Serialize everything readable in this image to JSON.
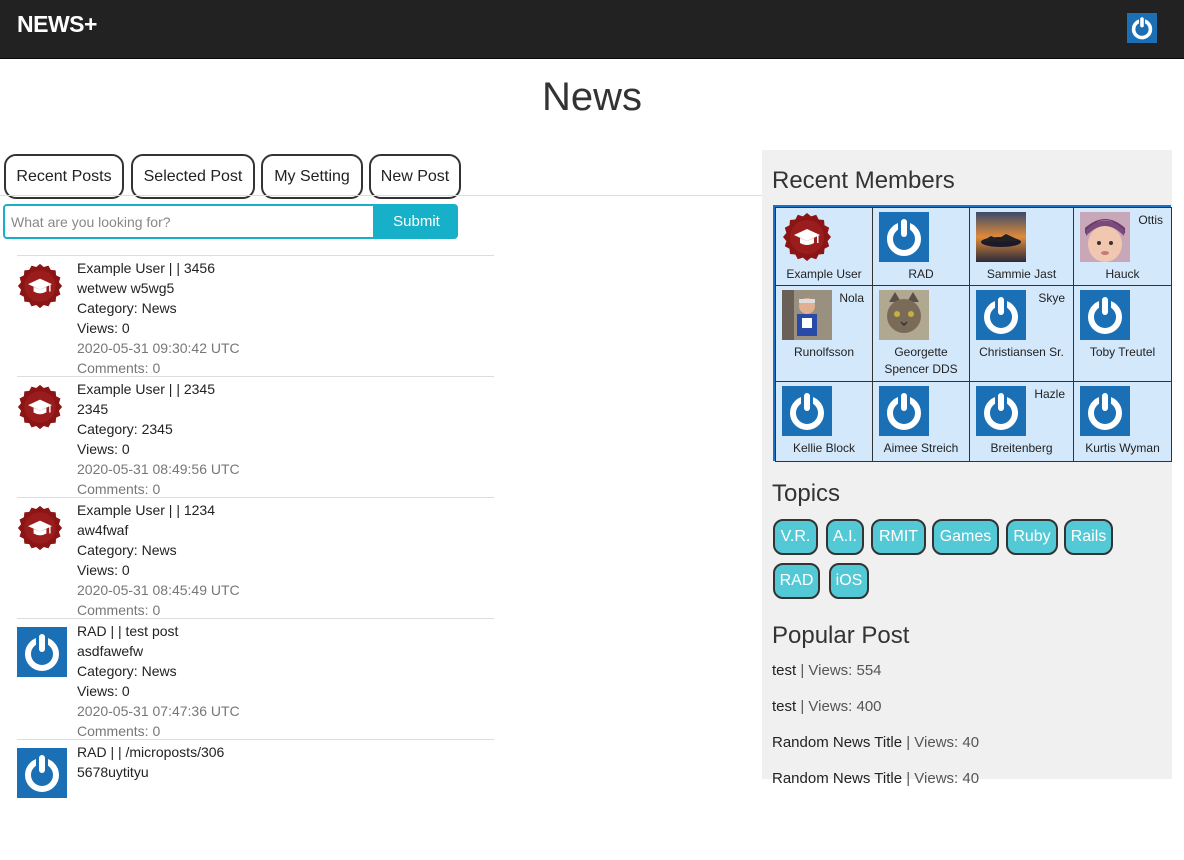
{
  "navbar": {
    "brand": "NEWS+"
  },
  "page_title": "News",
  "tabs": [
    "Recent Posts",
    "Selected Post",
    "My Setting",
    "New Post"
  ],
  "search": {
    "placeholder": "What are you looking for?",
    "button": "Submit"
  },
  "posts": [
    {
      "header": "Example User | | 3456",
      "body": "wetwew w5wg5",
      "category": "Category: News",
      "views": "Views: 0",
      "time": "2020-05-31 09:30:42 UTC",
      "comments": "Comments: 0",
      "avatar": "badge-icon"
    },
    {
      "header": "Example User | | 2345",
      "body": "2345",
      "category": "Category: 2345",
      "views": "Views: 0",
      "time": "2020-05-31 08:49:56 UTC",
      "comments": "Comments: 0",
      "avatar": "badge-icon"
    },
    {
      "header": "Example User | | 1234",
      "body": "aw4fwaf",
      "category": "Category: News",
      "views": "Views: 0",
      "time": "2020-05-31 08:45:49 UTC",
      "comments": "Comments: 0",
      "avatar": "badge-icon"
    },
    {
      "header": "RAD | | test post",
      "body": "asdfawefw",
      "category": "Category: News",
      "views": "Views: 0",
      "time": "2020-05-31 07:47:36 UTC",
      "comments": "Comments: 0",
      "avatar": "power-icon"
    },
    {
      "header": "RAD | | /microposts/306",
      "body": "5678uytityu",
      "category": "",
      "views": "",
      "time": "",
      "comments": "",
      "avatar": "power-icon"
    }
  ],
  "sidebar": {
    "members_heading": "Recent Members",
    "members": [
      {
        "first": "",
        "name": "Example User",
        "img": "badge"
      },
      {
        "first": "",
        "name": "RAD",
        "img": "power"
      },
      {
        "first": "",
        "name": "Sammie Jast",
        "img": "sunset"
      },
      {
        "first": "Ottis",
        "name": "Hauck",
        "img": "baby"
      },
      {
        "first": "Nola",
        "name": "Runolfsson",
        "img": "person"
      },
      {
        "first": "",
        "name": "Georgette Spencer DDS",
        "img": "cat"
      },
      {
        "first": "Skye",
        "name": "Christiansen Sr.",
        "img": "power"
      },
      {
        "first": "",
        "name": "Toby Treutel",
        "img": "power"
      },
      {
        "first": "",
        "name": "Kellie Block",
        "img": "power"
      },
      {
        "first": "",
        "name": "Aimee Streich",
        "img": "power"
      },
      {
        "first": "Hazle",
        "name": "Breitenberg",
        "img": "power"
      },
      {
        "first": "",
        "name": "Kurtis Wyman",
        "img": "power"
      }
    ],
    "topics_heading": "Topics",
    "topics": [
      "V.R.",
      "A.I.",
      "RMIT",
      "Games",
      "Ruby",
      "Rails",
      "RAD",
      "iOS"
    ],
    "popular_heading": "Popular Post",
    "popular": [
      {
        "title": "test",
        "views": " | Views: 554"
      },
      {
        "title": "test",
        "views": " | Views: 400"
      },
      {
        "title": "Random News Title",
        "views": " | Views: 40"
      },
      {
        "title": "Random News Title",
        "views": " | Views: 40"
      }
    ]
  },
  "colors": {
    "navbar": "#222222",
    "accent": "#17b0c9",
    "topic": "#54c9d6",
    "members_bg": "#d3e8fb",
    "avatar_blue": "#1a6fb5",
    "badge_red": "#8b1515"
  }
}
